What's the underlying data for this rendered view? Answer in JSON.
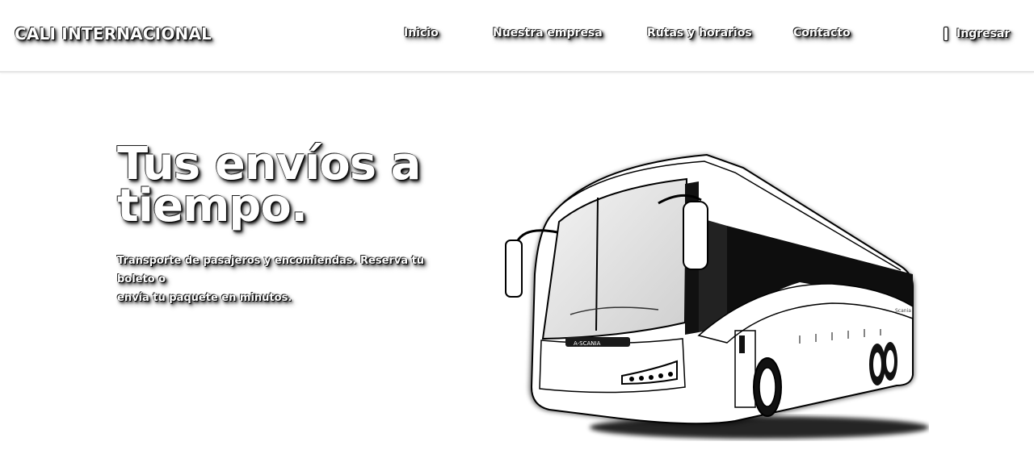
{
  "header": {
    "brand": "CALI INTERNACIONAL",
    "nav": [
      {
        "label": "Inicio"
      },
      {
        "label": "Nuestra empresa"
      },
      {
        "label": "Rutas y horarios"
      },
      {
        "label": "Contacto"
      }
    ],
    "login_label": "Ingresar"
  },
  "hero": {
    "title_line1": "Tus envíos a",
    "title_line2": "tiempo.",
    "subtitle_line1": "Transporte de pasajeros y encomiendas. Reserva tu boleto o",
    "subtitle_line2": "envía tu paquete en minutos."
  },
  "bus_image": {
    "front_plate_text": "A-SCANIA",
    "side_text": "Scania"
  }
}
